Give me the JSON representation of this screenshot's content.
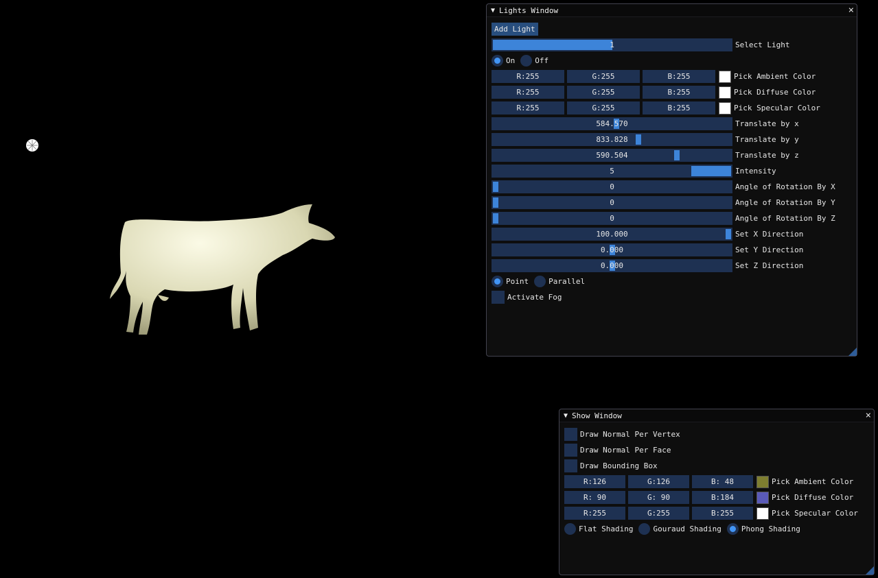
{
  "lights_window": {
    "title": "Lights Window",
    "add_light": "Add Light",
    "select_light": {
      "value": "1",
      "label": "Select Light",
      "fill_fraction": 0.5
    },
    "on_label": "On",
    "off_label": "Off",
    "on_selected": true,
    "color_rows": [
      {
        "r": "R:255",
        "g": "G:255",
        "b": "B:255",
        "swatch": "#ffffff",
        "label": "Pick Ambient Color"
      },
      {
        "r": "R:255",
        "g": "G:255",
        "b": "B:255",
        "swatch": "#ffffff",
        "label": "Pick Diffuse Color"
      },
      {
        "r": "R:255",
        "g": "G:255",
        "b": "B:255",
        "swatch": "#ffffff",
        "label": "Pick Specular Color"
      }
    ],
    "sliders": [
      {
        "value": "584.570",
        "label": "Translate by x",
        "fraction": 0.52
      },
      {
        "value": "833.828",
        "label": "Translate by y",
        "fraction": 0.615
      },
      {
        "value": "590.504",
        "label": "Translate by z",
        "fraction": 0.78
      },
      {
        "value": "5",
        "label": "Intensity",
        "fraction": 1.0
      },
      {
        "value": "0",
        "label": "Angle of Rotation By X",
        "fraction": 0.0
      },
      {
        "value": "0",
        "label": "Angle of Rotation By Y",
        "fraction": 0.0
      },
      {
        "value": "0",
        "label": "Angle of Rotation By Z",
        "fraction": 0.0
      },
      {
        "value": "100.000",
        "label": "Set X Direction",
        "fraction": 1.0
      },
      {
        "value": "0.000",
        "label": "Set Y Direction",
        "fraction": 0.5
      },
      {
        "value": "0.000",
        "label": "Set Z Direction",
        "fraction": 0.5
      }
    ],
    "point_label": "Point",
    "parallel_label": "Parallel",
    "point_selected": true,
    "fog_label": "Activate Fog"
  },
  "show_window": {
    "title": "Show Window",
    "checkboxes": [
      "Draw Normal Per Vertex",
      "Draw Normal Per Face",
      "Draw Bounding Box"
    ],
    "color_rows": [
      {
        "r": "R:126",
        "g": "G:126",
        "b": "B: 48",
        "swatch": "#7e7e30",
        "label": "Pick Ambient Color"
      },
      {
        "r": "R: 90",
        "g": "G: 90",
        "b": "B:184",
        "swatch": "#5a5ab8",
        "label": "Pick Diffuse Color"
      },
      {
        "r": "R:255",
        "g": "G:255",
        "b": "B:255",
        "swatch": "#ffffff",
        "label": "Pick Specular Color"
      }
    ],
    "shading": [
      "Flat Shading",
      "Gouraud Shading",
      "Phong Shading"
    ],
    "shading_selected": 2
  },
  "colors": {
    "accent": "#4295f5",
    "frame": "#1e3152",
    "button": "#284e7e",
    "model": "#e8e6c8"
  }
}
